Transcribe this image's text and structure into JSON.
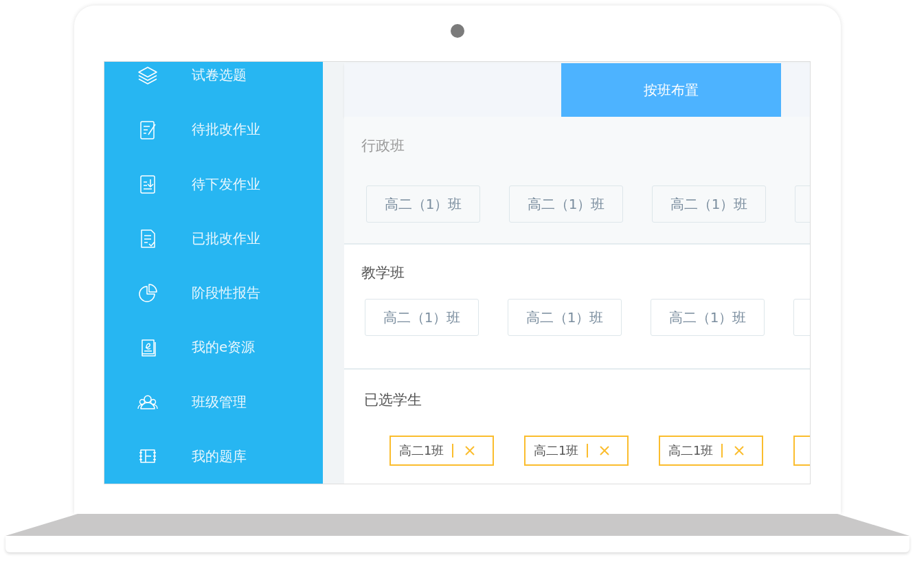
{
  "sidebar": {
    "items": [
      {
        "label": "试卷选题",
        "kind": "layers"
      },
      {
        "label": "待批改作业",
        "kind": "edit"
      },
      {
        "label": "待下发作业",
        "kind": "download"
      },
      {
        "label": "已批改作业",
        "kind": "check"
      },
      {
        "label": "阶段性报告",
        "kind": "pie"
      },
      {
        "label": "我的e资源",
        "kind": "book"
      },
      {
        "label": "班级管理",
        "kind": "people"
      },
      {
        "label": "我的题库",
        "kind": "bank"
      }
    ]
  },
  "tabs": [
    {
      "label": "按班布置",
      "selected": true
    }
  ],
  "sections": [
    {
      "title": "行政班",
      "kind": "classes",
      "items": [
        "高二（1）班",
        "高二（1）班",
        "高二（1）班"
      ]
    },
    {
      "title": "教学班",
      "kind": "classes",
      "items": [
        "高二（1）班",
        "高二（1）班",
        "高二（1）班"
      ]
    },
    {
      "title": "已选学生",
      "kind": "selected",
      "items": [
        "高二1班",
        "高二1班",
        "高二1班"
      ]
    }
  ]
}
